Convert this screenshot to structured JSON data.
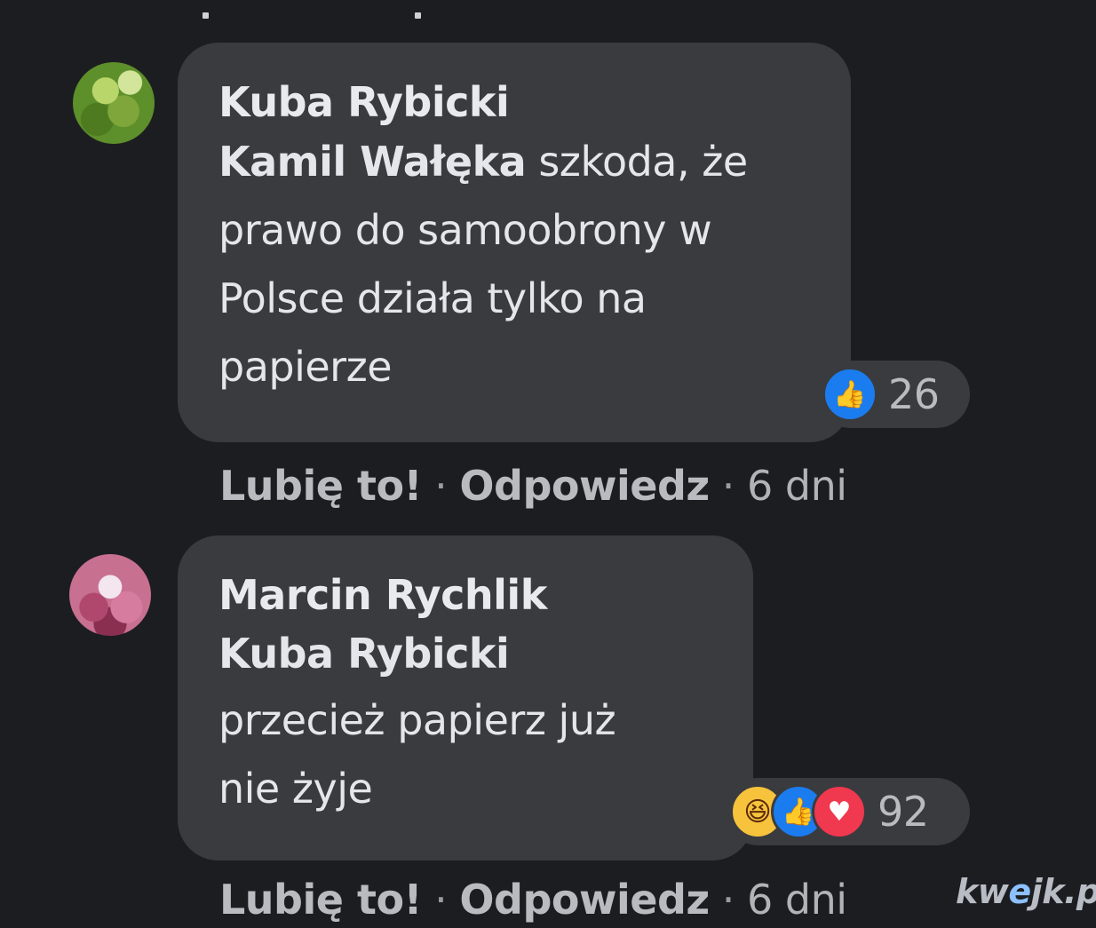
{
  "comments": [
    {
      "author": "Kuba Rybicki",
      "mention": "Kamil Wałęka",
      "text_line1_rest": " szkoda, że",
      "text_line2": "prawo do samoobrony w",
      "text_line3": "Polsce działa tylko na",
      "text_line4": "papierze",
      "reactions": [
        "like-icon"
      ],
      "reaction_count": "26",
      "actions": {
        "like": "Lubię to!",
        "reply": "Odpowiedz",
        "time": "6 dni",
        "sep": "·"
      }
    },
    {
      "author": "Marcin Rychlik",
      "mention": "Kuba Rybicki",
      "text_line1": "przecież papierz już",
      "text_line2": "nie żyje",
      "reactions": [
        "haha-icon",
        "like-icon",
        "love-icon"
      ],
      "reaction_count": "92",
      "actions": {
        "like": "Lubię to!",
        "reply": "Odpowiedz",
        "time": "6 dni",
        "sep": "·"
      }
    }
  ],
  "watermark": {
    "part1": "kw",
    "part2": "e",
    "part3": "jk.p"
  },
  "colors": {
    "background": "#1c1d21",
    "bubble": "#3a3b3f",
    "like": "#1b7cef",
    "love": "#f0384f",
    "haha": "#f7c33c"
  }
}
